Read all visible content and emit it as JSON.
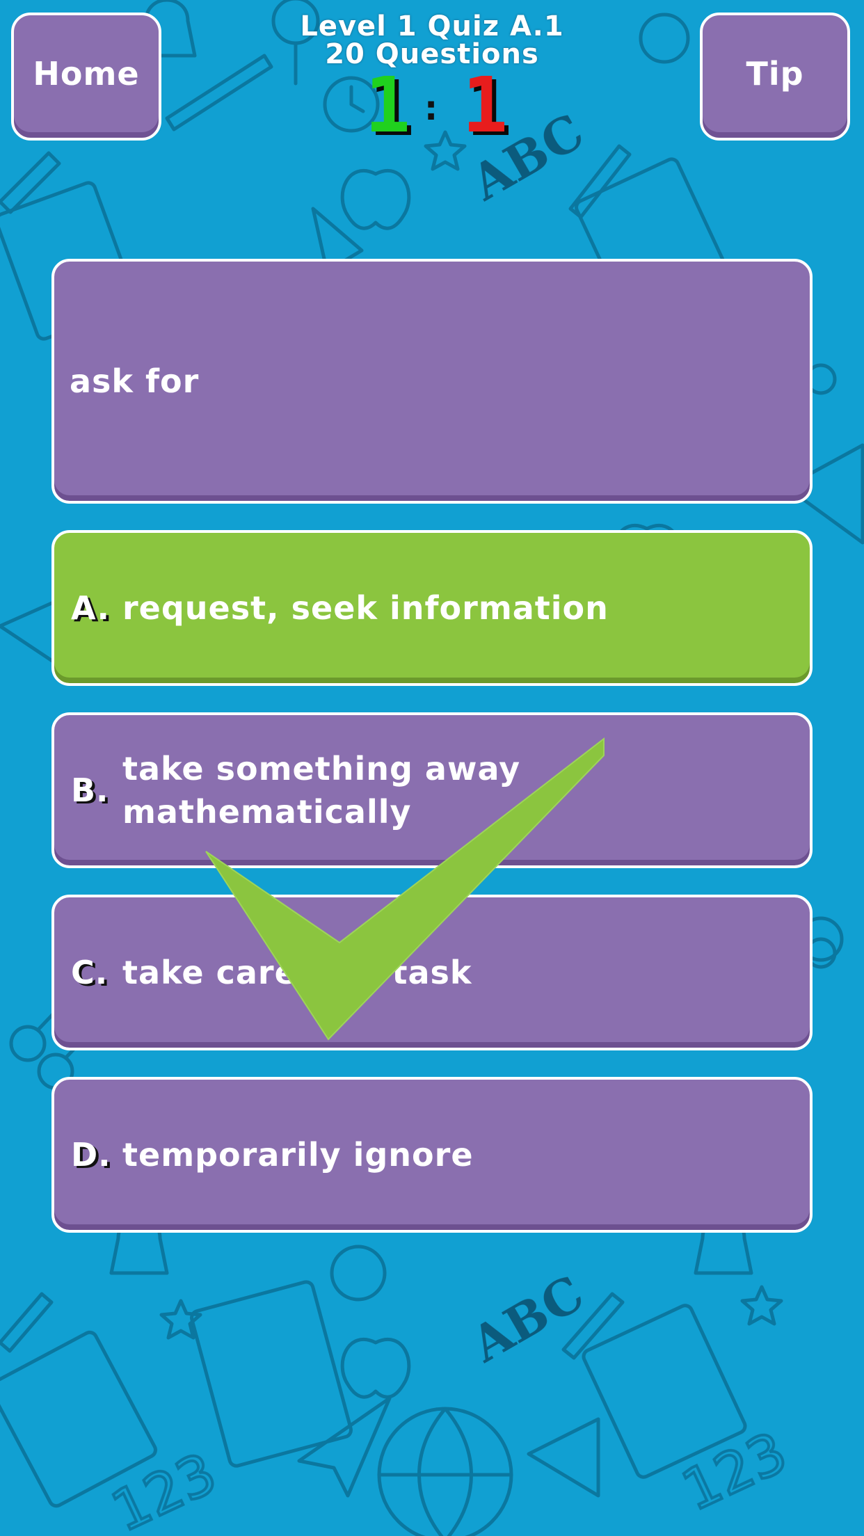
{
  "header": {
    "home_label": "Home",
    "tip_label": "Tip",
    "quiz_title": "Level 1 Quiz A.1",
    "question_count": "20 Questions",
    "score_correct": "1",
    "score_separator": ":",
    "score_wrong": "1"
  },
  "question": {
    "text": "ask for"
  },
  "options": [
    {
      "letter": "A.",
      "text": "request, seek information",
      "state": "correct"
    },
    {
      "letter": "B.",
      "text": "take something away mathematically",
      "state": "default"
    },
    {
      "letter": "C.",
      "text": "take care of a task",
      "state": "default"
    },
    {
      "letter": "D.",
      "text": "temporarily ignore",
      "state": "default"
    }
  ],
  "colors": {
    "background": "#11a0d2",
    "card_purple": "#8a6faf",
    "correct_green": "#8bc53f",
    "score_green": "#20d11e",
    "score_red": "#e81d1d"
  },
  "icons": {
    "feedback": "checkmark-icon"
  }
}
